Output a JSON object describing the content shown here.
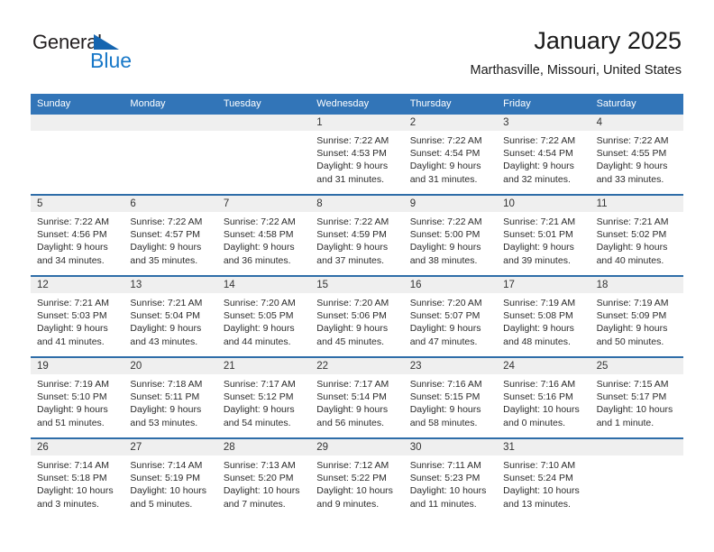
{
  "brand": {
    "name_part1": "General",
    "name_part2": "Blue",
    "triangle_icon": "triangle-icon",
    "accent_color": "#1878c8"
  },
  "header": {
    "title": "January 2025",
    "location": "Marthasville, Missouri, United States",
    "header_bg_color": "#3275b8"
  },
  "weekdays": [
    "Sunday",
    "Monday",
    "Tuesday",
    "Wednesday",
    "Thursday",
    "Friday",
    "Saturday"
  ],
  "weeks": [
    [
      {
        "day": "",
        "empty": true
      },
      {
        "day": "",
        "empty": true
      },
      {
        "day": "",
        "empty": true
      },
      {
        "day": "1",
        "sunrise": "Sunrise: 7:22 AM",
        "sunset": "Sunset: 4:53 PM",
        "daylight1": "Daylight: 9 hours",
        "daylight2": "and 31 minutes."
      },
      {
        "day": "2",
        "sunrise": "Sunrise: 7:22 AM",
        "sunset": "Sunset: 4:54 PM",
        "daylight1": "Daylight: 9 hours",
        "daylight2": "and 31 minutes."
      },
      {
        "day": "3",
        "sunrise": "Sunrise: 7:22 AM",
        "sunset": "Sunset: 4:54 PM",
        "daylight1": "Daylight: 9 hours",
        "daylight2": "and 32 minutes."
      },
      {
        "day": "4",
        "sunrise": "Sunrise: 7:22 AM",
        "sunset": "Sunset: 4:55 PM",
        "daylight1": "Daylight: 9 hours",
        "daylight2": "and 33 minutes."
      }
    ],
    [
      {
        "day": "5",
        "sunrise": "Sunrise: 7:22 AM",
        "sunset": "Sunset: 4:56 PM",
        "daylight1": "Daylight: 9 hours",
        "daylight2": "and 34 minutes."
      },
      {
        "day": "6",
        "sunrise": "Sunrise: 7:22 AM",
        "sunset": "Sunset: 4:57 PM",
        "daylight1": "Daylight: 9 hours",
        "daylight2": "and 35 minutes."
      },
      {
        "day": "7",
        "sunrise": "Sunrise: 7:22 AM",
        "sunset": "Sunset: 4:58 PM",
        "daylight1": "Daylight: 9 hours",
        "daylight2": "and 36 minutes."
      },
      {
        "day": "8",
        "sunrise": "Sunrise: 7:22 AM",
        "sunset": "Sunset: 4:59 PM",
        "daylight1": "Daylight: 9 hours",
        "daylight2": "and 37 minutes."
      },
      {
        "day": "9",
        "sunrise": "Sunrise: 7:22 AM",
        "sunset": "Sunset: 5:00 PM",
        "daylight1": "Daylight: 9 hours",
        "daylight2": "and 38 minutes."
      },
      {
        "day": "10",
        "sunrise": "Sunrise: 7:21 AM",
        "sunset": "Sunset: 5:01 PM",
        "daylight1": "Daylight: 9 hours",
        "daylight2": "and 39 minutes."
      },
      {
        "day": "11",
        "sunrise": "Sunrise: 7:21 AM",
        "sunset": "Sunset: 5:02 PM",
        "daylight1": "Daylight: 9 hours",
        "daylight2": "and 40 minutes."
      }
    ],
    [
      {
        "day": "12",
        "sunrise": "Sunrise: 7:21 AM",
        "sunset": "Sunset: 5:03 PM",
        "daylight1": "Daylight: 9 hours",
        "daylight2": "and 41 minutes."
      },
      {
        "day": "13",
        "sunrise": "Sunrise: 7:21 AM",
        "sunset": "Sunset: 5:04 PM",
        "daylight1": "Daylight: 9 hours",
        "daylight2": "and 43 minutes."
      },
      {
        "day": "14",
        "sunrise": "Sunrise: 7:20 AM",
        "sunset": "Sunset: 5:05 PM",
        "daylight1": "Daylight: 9 hours",
        "daylight2": "and 44 minutes."
      },
      {
        "day": "15",
        "sunrise": "Sunrise: 7:20 AM",
        "sunset": "Sunset: 5:06 PM",
        "daylight1": "Daylight: 9 hours",
        "daylight2": "and 45 minutes."
      },
      {
        "day": "16",
        "sunrise": "Sunrise: 7:20 AM",
        "sunset": "Sunset: 5:07 PM",
        "daylight1": "Daylight: 9 hours",
        "daylight2": "and 47 minutes."
      },
      {
        "day": "17",
        "sunrise": "Sunrise: 7:19 AM",
        "sunset": "Sunset: 5:08 PM",
        "daylight1": "Daylight: 9 hours",
        "daylight2": "and 48 minutes."
      },
      {
        "day": "18",
        "sunrise": "Sunrise: 7:19 AM",
        "sunset": "Sunset: 5:09 PM",
        "daylight1": "Daylight: 9 hours",
        "daylight2": "and 50 minutes."
      }
    ],
    [
      {
        "day": "19",
        "sunrise": "Sunrise: 7:19 AM",
        "sunset": "Sunset: 5:10 PM",
        "daylight1": "Daylight: 9 hours",
        "daylight2": "and 51 minutes."
      },
      {
        "day": "20",
        "sunrise": "Sunrise: 7:18 AM",
        "sunset": "Sunset: 5:11 PM",
        "daylight1": "Daylight: 9 hours",
        "daylight2": "and 53 minutes."
      },
      {
        "day": "21",
        "sunrise": "Sunrise: 7:17 AM",
        "sunset": "Sunset: 5:12 PM",
        "daylight1": "Daylight: 9 hours",
        "daylight2": "and 54 minutes."
      },
      {
        "day": "22",
        "sunrise": "Sunrise: 7:17 AM",
        "sunset": "Sunset: 5:14 PM",
        "daylight1": "Daylight: 9 hours",
        "daylight2": "and 56 minutes."
      },
      {
        "day": "23",
        "sunrise": "Sunrise: 7:16 AM",
        "sunset": "Sunset: 5:15 PM",
        "daylight1": "Daylight: 9 hours",
        "daylight2": "and 58 minutes."
      },
      {
        "day": "24",
        "sunrise": "Sunrise: 7:16 AM",
        "sunset": "Sunset: 5:16 PM",
        "daylight1": "Daylight: 10 hours",
        "daylight2": "and 0 minutes."
      },
      {
        "day": "25",
        "sunrise": "Sunrise: 7:15 AM",
        "sunset": "Sunset: 5:17 PM",
        "daylight1": "Daylight: 10 hours",
        "daylight2": "and 1 minute."
      }
    ],
    [
      {
        "day": "26",
        "sunrise": "Sunrise: 7:14 AM",
        "sunset": "Sunset: 5:18 PM",
        "daylight1": "Daylight: 10 hours",
        "daylight2": "and 3 minutes."
      },
      {
        "day": "27",
        "sunrise": "Sunrise: 7:14 AM",
        "sunset": "Sunset: 5:19 PM",
        "daylight1": "Daylight: 10 hours",
        "daylight2": "and 5 minutes."
      },
      {
        "day": "28",
        "sunrise": "Sunrise: 7:13 AM",
        "sunset": "Sunset: 5:20 PM",
        "daylight1": "Daylight: 10 hours",
        "daylight2": "and 7 minutes."
      },
      {
        "day": "29",
        "sunrise": "Sunrise: 7:12 AM",
        "sunset": "Sunset: 5:22 PM",
        "daylight1": "Daylight: 10 hours",
        "daylight2": "and 9 minutes."
      },
      {
        "day": "30",
        "sunrise": "Sunrise: 7:11 AM",
        "sunset": "Sunset: 5:23 PM",
        "daylight1": "Daylight: 10 hours",
        "daylight2": "and 11 minutes."
      },
      {
        "day": "31",
        "sunrise": "Sunrise: 7:10 AM",
        "sunset": "Sunset: 5:24 PM",
        "daylight1": "Daylight: 10 hours",
        "daylight2": "and 13 minutes."
      },
      {
        "day": "",
        "empty": true
      }
    ]
  ]
}
